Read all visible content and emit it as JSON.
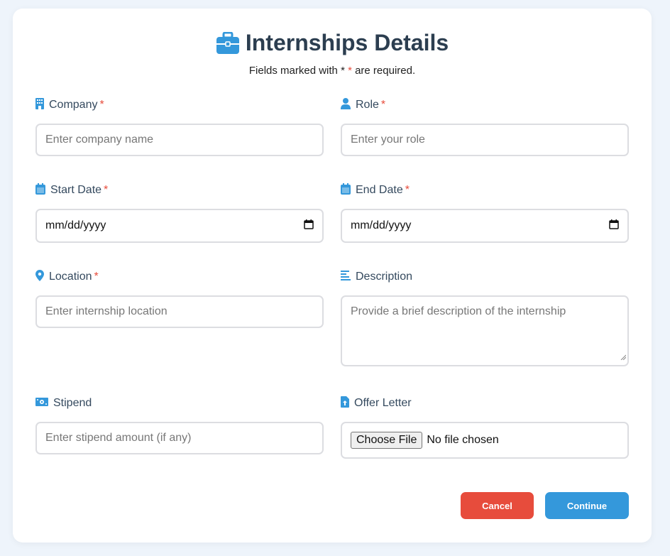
{
  "header": {
    "title": "Internships Details",
    "required_note_prefix": "Fields marked with * ",
    "required_note_star": "*",
    "required_note_suffix": " are required."
  },
  "fields": {
    "company": {
      "label": "Company",
      "required": "*",
      "placeholder": "Enter company name",
      "icon": "building-icon"
    },
    "role": {
      "label": "Role",
      "required": "*",
      "placeholder": "Enter your role",
      "icon": "user-icon"
    },
    "start_date": {
      "label": "Start Date",
      "required": "*",
      "value": "mm/dd/yyyy",
      "icon": "calendar-icon"
    },
    "end_date": {
      "label": "End Date",
      "required": "*",
      "value": "mm/dd/yyyy",
      "icon": "calendar-icon"
    },
    "location": {
      "label": "Location",
      "required": "*",
      "placeholder": "Enter internship location",
      "icon": "map-pin-icon"
    },
    "description": {
      "label": "Description",
      "placeholder": "Provide a brief description of the internship",
      "icon": "align-left-icon"
    },
    "stipend": {
      "label": "Stipend",
      "placeholder": "Enter stipend amount (if any)",
      "icon": "money-icon"
    },
    "offer_letter": {
      "label": "Offer Letter",
      "button": "Choose File",
      "status": "No file chosen",
      "icon": "file-upload-icon"
    }
  },
  "actions": {
    "cancel": "Cancel",
    "continue": "Continue"
  },
  "colors": {
    "accent": "#3498db",
    "danger": "#e74c3c",
    "text": "#2c3e50"
  }
}
